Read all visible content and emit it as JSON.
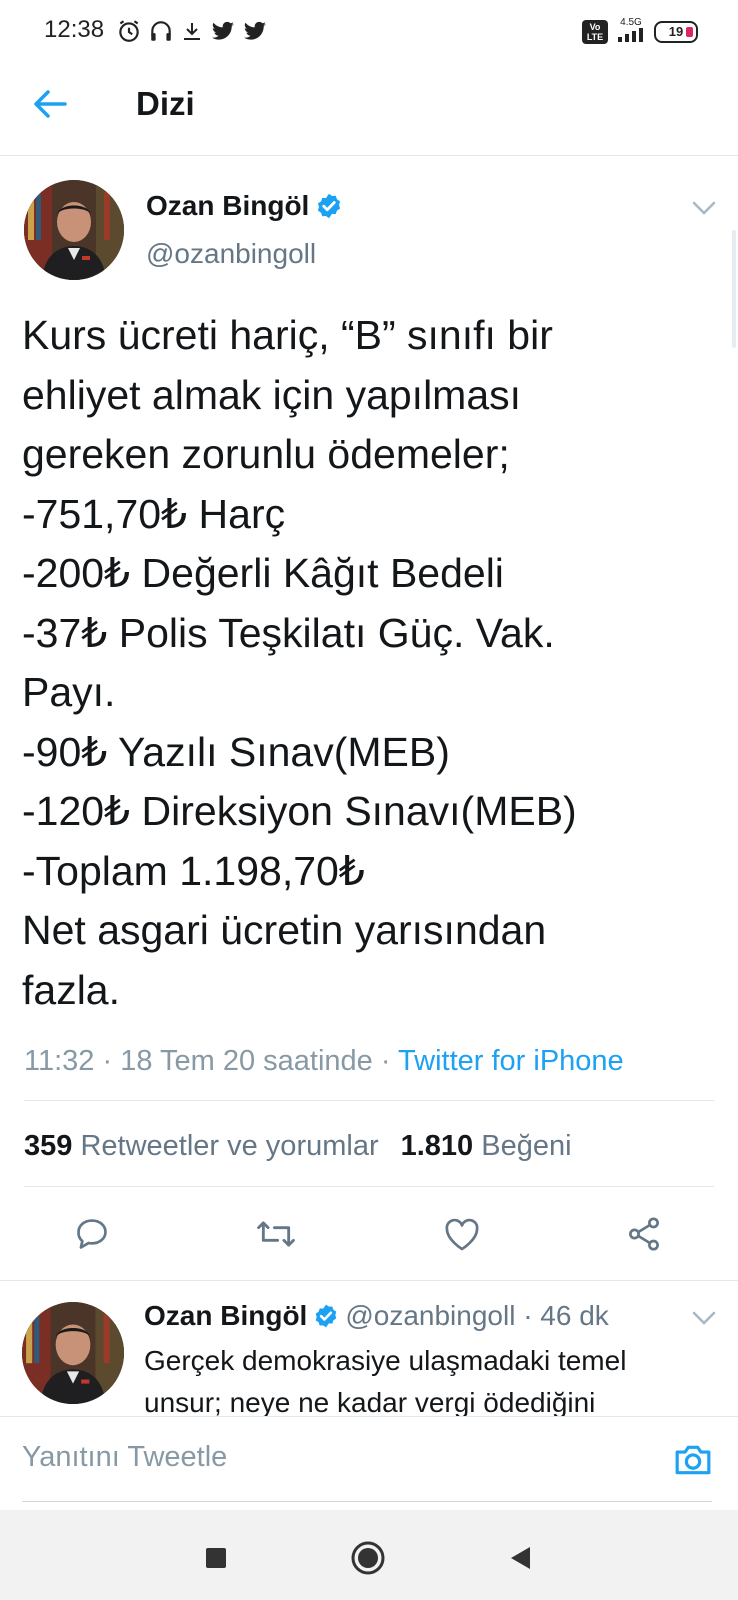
{
  "status_bar": {
    "time": "12:38",
    "network_type": "4.5G",
    "volte": "Vo LTE",
    "battery": "19",
    "icons": [
      "alarm-icon",
      "headset-icon",
      "download-icon",
      "twitter-bird-icon",
      "twitter-bird-icon",
      "volte-icon",
      "signal-icon",
      "battery-icon"
    ]
  },
  "header": {
    "back_icon": "arrow-left-icon",
    "title": "Dizi"
  },
  "tweet": {
    "author_name": "Ozan Bingöl",
    "handle": "@ozanbingoll",
    "verified": true,
    "text": "Kurs ücreti hariç, “B” sınıfı bir\nehliyet almak için yapılması\ngereken zorunlu ödemeler;\n-751,70₺ Harç\n-200₺ Değerli Kâğıt Bedeli\n-37₺ Polis Teşkilatı Güç. Vak.\nPayı.\n-90₺ Yazılı Sınav(MEB)\n-120₺ Direksiyon Sınavı(MEB)\n-Toplam 1.198,70₺\nNet asgari ücretin yarısından\nfazla.",
    "meta_time": "11:32 · 18 Tem 20 saatinde · ",
    "source": "Twitter for iPhone",
    "retweets_count": "359",
    "retweets_label": "Retweetler ve yorumlar",
    "likes_count": "1.810",
    "likes_label": "Beğeni",
    "actions": [
      "reply-icon",
      "retweet-icon",
      "like-icon",
      "share-icon"
    ]
  },
  "reply": {
    "author_name": "Ozan Bingöl",
    "handle_time": "@ozanbingoll · 46 dk",
    "text": "Gerçek demokrasiye ulaşmadaki temel\nunsur; neye ne kadar vergi ödediğini"
  },
  "compose": {
    "placeholder": "Yanıtını Tweetle",
    "camera_icon": "camera-icon"
  },
  "colors": {
    "accent": "#1da1f2",
    "text": "#14171a",
    "muted": "#657786",
    "divider": "#e1e8ed"
  }
}
